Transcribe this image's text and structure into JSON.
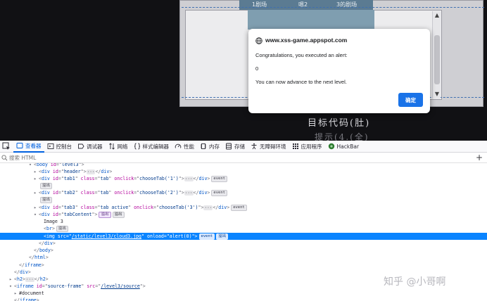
{
  "page": {
    "frame_tabs": [
      "1剧场",
      "嗯2",
      "3的剧场"
    ],
    "target_code": "目标代码(肚)",
    "hint": "提示(4.(全)"
  },
  "alert": {
    "origin": "www.xss-game.appspot.com",
    "message": "Congratulations, you executed an alert:",
    "value": "0",
    "advance": "You can now advance to the next level.",
    "ok_label": "确定"
  },
  "devtools": {
    "tabs": [
      {
        "label": "查看器",
        "icon": "inspector-icon",
        "active": true
      },
      {
        "label": "控制台",
        "icon": "console-icon"
      },
      {
        "label": "调试器",
        "icon": "debugger-icon"
      },
      {
        "label": "网络",
        "icon": "network-icon"
      },
      {
        "label": "样式编辑器",
        "icon": "style-editor-icon"
      },
      {
        "label": "性能",
        "icon": "performance-icon"
      },
      {
        "label": "内存",
        "icon": "memory-icon"
      },
      {
        "label": "存储",
        "icon": "storage-icon"
      },
      {
        "label": "无障碍环境",
        "icon": "accessibility-icon"
      },
      {
        "label": "应用程序",
        "icon": "application-icon"
      },
      {
        "label": "HackBar",
        "icon": "hackbar-icon"
      }
    ],
    "search_placeholder": "搜索 HTML",
    "add_label": "+",
    "accent": "#0061e0",
    "selection": "#0a84ff"
  },
  "markup": {
    "ellipsis": "···",
    "event": "event",
    "overflow": "溢出",
    "flex": "flex",
    "tokens": {
      "body": "body",
      "div": "div",
      "img": "img",
      "br": "br",
      "iframe": "iframe",
      "html": "html",
      "h2": "h2",
      "id": "id",
      "class": "class",
      "onclick": "onclick",
      "src": "src",
      "onload": "onload",
      "level3": "level3",
      "header": "header",
      "tab1": "tab1",
      "tab2": "tab2",
      "tab3": "tab3",
      "tabContent": "tabContent",
      "tab": "tab",
      "tab_active": "tab active",
      "choose1": "chooseTab('1')",
      "choose2": "chooseTab('2')",
      "choose3": "chooseTab('3')",
      "img_src": "/static/level3/cloud3.jpg",
      "alert0": "alert(0)",
      "source_frame": "source-frame",
      "source_src": "/level3/source",
      "image3": "Image 3",
      "document": "#document"
    }
  },
  "watermark": "知乎 @小哥啊"
}
